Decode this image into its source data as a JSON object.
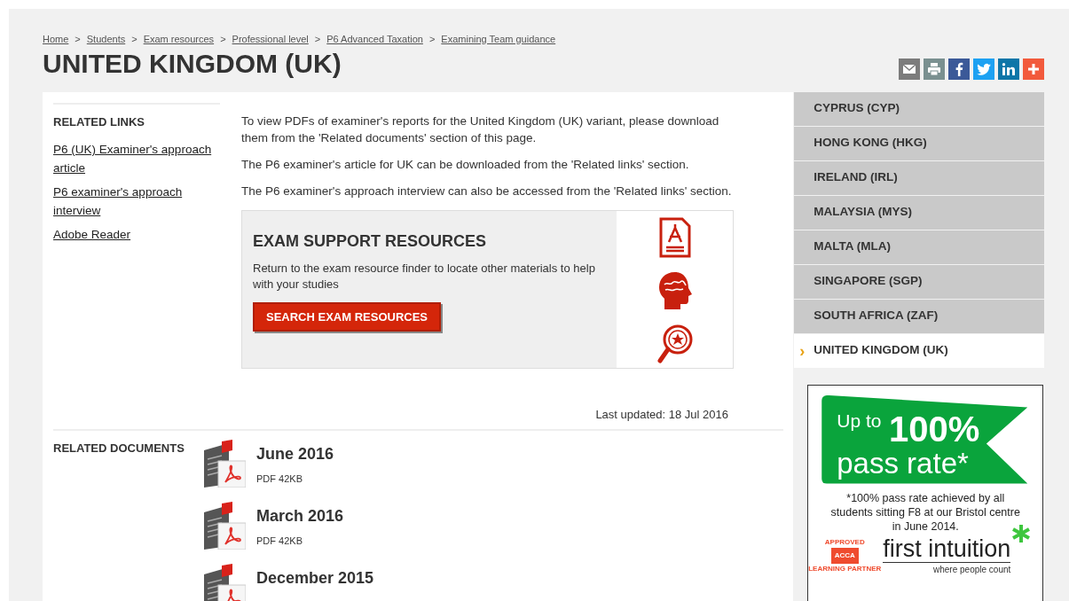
{
  "breadcrumb": [
    "Home",
    "Students",
    "Exam resources",
    "Professional level",
    "P6 Advanced Taxation",
    "Examining Team guidance"
  ],
  "breadcrumb_separator": ">",
  "title": "UNITED KINGDOM (UK)",
  "related_links": {
    "heading": "RELATED LINKS",
    "links": [
      "P6 (UK) Examiner's approach article",
      "P6 examiner's approach interview",
      "Adobe Reader"
    ]
  },
  "paragraphs": [
    "To view PDFs of examiner's reports for the United Kingdom (UK) variant, please download them from the 'Related documents' section of this page.",
    "The P6 examiner's article for UK can be downloaded from the 'Related links' section.",
    "The P6 examiner's approach interview can also be accessed from the 'Related links' section."
  ],
  "support_box": {
    "heading": "EXAM SUPPORT RESOURCES",
    "text": "Return to the exam resource finder to locate other materials to help with your studies",
    "button": "SEARCH EXAM RESOURCES"
  },
  "last_updated": "Last updated: 18 Jul 2016",
  "related_documents": {
    "heading": "RELATED DOCUMENTS",
    "items": [
      {
        "title": "June 2016",
        "meta": "PDF 42KB"
      },
      {
        "title": "March 2016",
        "meta": "PDF 42KB"
      },
      {
        "title": "December 2015"
      }
    ]
  },
  "sidebar": {
    "marker": "›",
    "items": [
      {
        "label": "CYPRUS (CYP)",
        "selected": false
      },
      {
        "label": "HONG KONG (HKG)",
        "selected": false
      },
      {
        "label": "IRELAND (IRL)",
        "selected": false
      },
      {
        "label": "MALAYSIA (MYS)",
        "selected": false
      },
      {
        "label": "MALTA (MLA)",
        "selected": false
      },
      {
        "label": "SINGAPORE (SGP)",
        "selected": false
      },
      {
        "label": "SOUTH AFRICA (ZAF)",
        "selected": false
      },
      {
        "label": "UNITED KINGDOM (UK)",
        "selected": true
      }
    ]
  },
  "ad": {
    "prefix": "Up to",
    "figure": "100%",
    "headline": "pass rate*",
    "footnote": "*100% pass rate achieved by all students sitting F8 at our Bristol centre in June 2014.",
    "badge": "ACCA",
    "badge_ring_top": "APPROVED",
    "badge_ring_bottom": "LEARNING PARTNER",
    "brand": "first intuition",
    "tagline": "where people count"
  }
}
